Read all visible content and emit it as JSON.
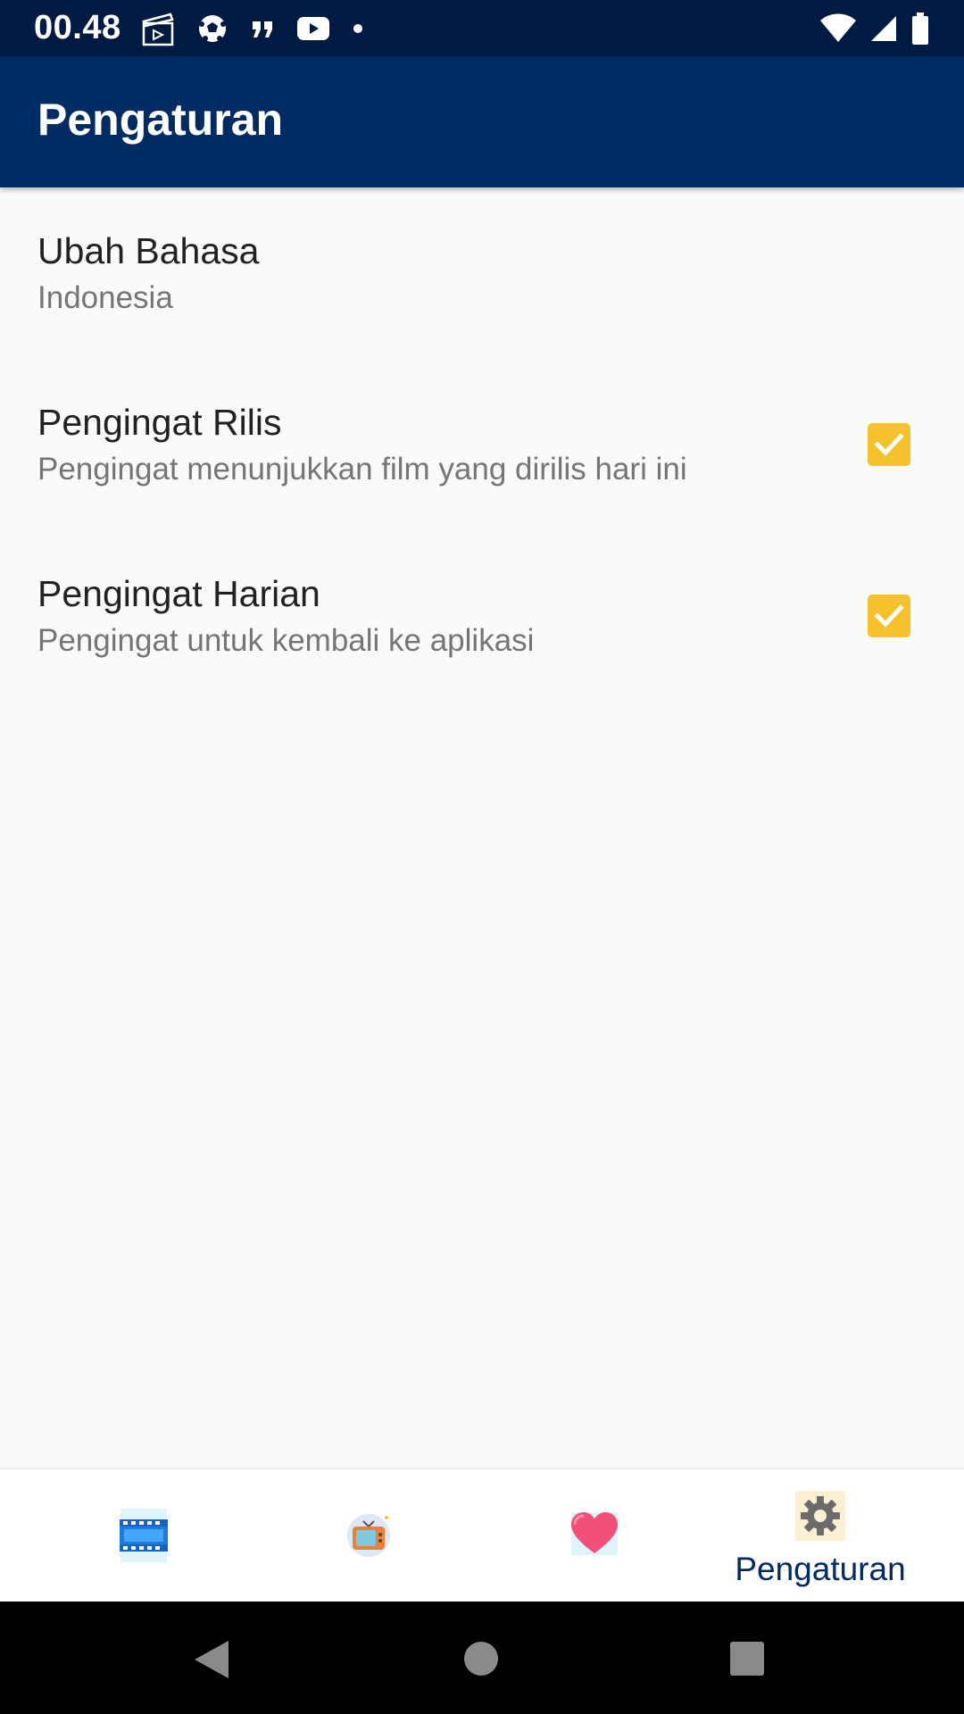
{
  "status_bar": {
    "time": "00.48",
    "left_icons": [
      "clapperboard-icon",
      "soccer-ball-icon",
      "quote-icon",
      "youtube-icon",
      "dot-icon"
    ],
    "right_icons": [
      "wifi-icon",
      "signal-icon",
      "battery-icon"
    ]
  },
  "app_bar": {
    "title": "Pengaturan"
  },
  "settings": [
    {
      "title": "Ubah Bahasa",
      "summary": "Indonesia"
    },
    {
      "title": "Pengingat Rilis",
      "summary": "Pengingat menunjukkan film yang dirilis hari ini",
      "checked": true
    },
    {
      "title": "Pengingat Harian",
      "summary": "Pengingat untuk kembali ke aplikasi",
      "checked": true
    }
  ],
  "bottom_nav": {
    "items": [
      {
        "icon": "movie-film-icon",
        "label": ""
      },
      {
        "icon": "tv-icon",
        "label": ""
      },
      {
        "icon": "heart-icon",
        "label": ""
      },
      {
        "icon": "gear-icon",
        "label": "Pengaturan",
        "selected": true
      }
    ]
  },
  "system_nav": [
    "back-icon",
    "home-icon",
    "recents-icon"
  ],
  "colors": {
    "status_bar": "#001a42",
    "app_bar": "#002b63",
    "checkbox": "#f6c12a",
    "nav_label": "#002b63"
  }
}
